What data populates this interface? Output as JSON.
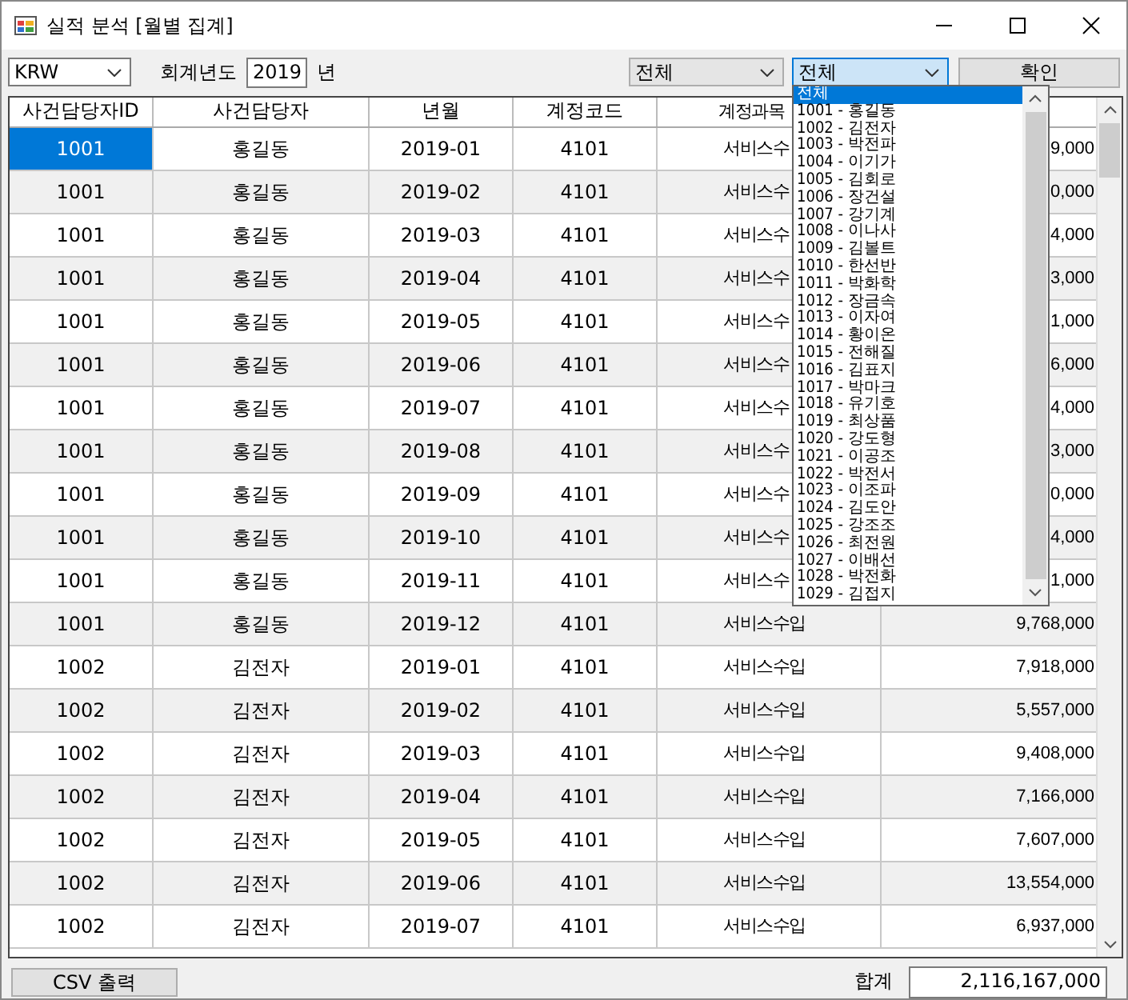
{
  "window": {
    "title": "실적 분석 [월별 집계]"
  },
  "toolbar": {
    "currency": "KRW",
    "year_label": "회계년도",
    "year": "2019",
    "year_unit": "년",
    "filter_1": "전체",
    "filter_2": "전체",
    "confirm_button": "확인"
  },
  "dropdown": {
    "items": [
      {
        "label": "전체",
        "selected": true
      },
      {
        "label": "1001 - 홍길동",
        "selected": false
      },
      {
        "label": "1002 - 김전자",
        "selected": false
      },
      {
        "label": "1003 - 박전파",
        "selected": false
      },
      {
        "label": "1004 - 이기가",
        "selected": false
      },
      {
        "label": "1005 - 김회로",
        "selected": false
      },
      {
        "label": "1006 - 장건설",
        "selected": false
      },
      {
        "label": "1007 - 강기계",
        "selected": false
      },
      {
        "label": "1008 - 이나사",
        "selected": false
      },
      {
        "label": "1009 - 김볼트",
        "selected": false
      },
      {
        "label": "1010 - 한선반",
        "selected": false
      },
      {
        "label": "1011 - 박화학",
        "selected": false
      },
      {
        "label": "1012 - 장금속",
        "selected": false
      },
      {
        "label": "1013 - 이자여",
        "selected": false
      },
      {
        "label": "1014 - 황이온",
        "selected": false
      },
      {
        "label": "1015 - 전해질",
        "selected": false
      },
      {
        "label": "1016 - 김표지",
        "selected": false
      },
      {
        "label": "1017 - 박마크",
        "selected": false
      },
      {
        "label": "1018 - 유기호",
        "selected": false
      },
      {
        "label": "1019 - 최상품",
        "selected": false
      },
      {
        "label": "1020 - 강도형",
        "selected": false
      },
      {
        "label": "1021 - 이공조",
        "selected": false
      },
      {
        "label": "1022 - 박전서",
        "selected": false
      },
      {
        "label": "1023 - 이조파",
        "selected": false
      },
      {
        "label": "1024 - 김도안",
        "selected": false
      },
      {
        "label": "1025 - 강조조",
        "selected": false
      },
      {
        "label": "1026 - 최전원",
        "selected": false
      },
      {
        "label": "1027 - 이배선",
        "selected": false
      },
      {
        "label": "1028 - 박전화",
        "selected": false
      },
      {
        "label": "1029 - 김접지",
        "selected": false
      }
    ]
  },
  "table": {
    "columns": [
      "사건담당자ID",
      "사건담당자",
      "년월",
      "계정코드",
      "계정과목"
    ],
    "rows": [
      {
        "cells": [
          "1001",
          "홍길동",
          "2019-01",
          "4101",
          "서비스수",
          "9,000"
        ],
        "selected": true
      },
      {
        "cells": [
          "1001",
          "홍길동",
          "2019-02",
          "4101",
          "서비스수",
          "0,000"
        ],
        "selected": false
      },
      {
        "cells": [
          "1001",
          "홍길동",
          "2019-03",
          "4101",
          "서비스수",
          "4,000"
        ],
        "selected": false
      },
      {
        "cells": [
          "1001",
          "홍길동",
          "2019-04",
          "4101",
          "서비스수",
          "3,000"
        ],
        "selected": false
      },
      {
        "cells": [
          "1001",
          "홍길동",
          "2019-05",
          "4101",
          "서비스수",
          "1,000"
        ],
        "selected": false
      },
      {
        "cells": [
          "1001",
          "홍길동",
          "2019-06",
          "4101",
          "서비스수",
          "6,000"
        ],
        "selected": false
      },
      {
        "cells": [
          "1001",
          "홍길동",
          "2019-07",
          "4101",
          "서비스수",
          "4,000"
        ],
        "selected": false
      },
      {
        "cells": [
          "1001",
          "홍길동",
          "2019-08",
          "4101",
          "서비스수",
          "3,000"
        ],
        "selected": false
      },
      {
        "cells": [
          "1001",
          "홍길동",
          "2019-09",
          "4101",
          "서비스수",
          "0,000"
        ],
        "selected": false
      },
      {
        "cells": [
          "1001",
          "홍길동",
          "2019-10",
          "4101",
          "서비스수",
          "4,000"
        ],
        "selected": false
      },
      {
        "cells": [
          "1001",
          "홍길동",
          "2019-11",
          "4101",
          "서비스수",
          "1,000"
        ],
        "selected": false
      },
      {
        "cells": [
          "1001",
          "홍길동",
          "2019-12",
          "4101",
          "서비스수입",
          "9,768,000"
        ],
        "selected": false
      },
      {
        "cells": [
          "1002",
          "김전자",
          "2019-01",
          "4101",
          "서비스수입",
          "7,918,000"
        ],
        "selected": false
      },
      {
        "cells": [
          "1002",
          "김전자",
          "2019-02",
          "4101",
          "서비스수입",
          "5,557,000"
        ],
        "selected": false
      },
      {
        "cells": [
          "1002",
          "김전자",
          "2019-03",
          "4101",
          "서비스수입",
          "9,408,000"
        ],
        "selected": false
      },
      {
        "cells": [
          "1002",
          "김전자",
          "2019-04",
          "4101",
          "서비스수입",
          "7,166,000"
        ],
        "selected": false
      },
      {
        "cells": [
          "1002",
          "김전자",
          "2019-05",
          "4101",
          "서비스수입",
          "7,607,000"
        ],
        "selected": false
      },
      {
        "cells": [
          "1002",
          "김전자",
          "2019-06",
          "4101",
          "서비스수입",
          "13,554,000"
        ],
        "selected": false
      },
      {
        "cells": [
          "1002",
          "김전자",
          "2019-07",
          "4101",
          "서비스수입",
          "6,937,000"
        ],
        "selected": false
      }
    ]
  },
  "footer": {
    "csv_button": "CSV 출력",
    "total_label": "합계",
    "total": "2,116,167,000"
  }
}
